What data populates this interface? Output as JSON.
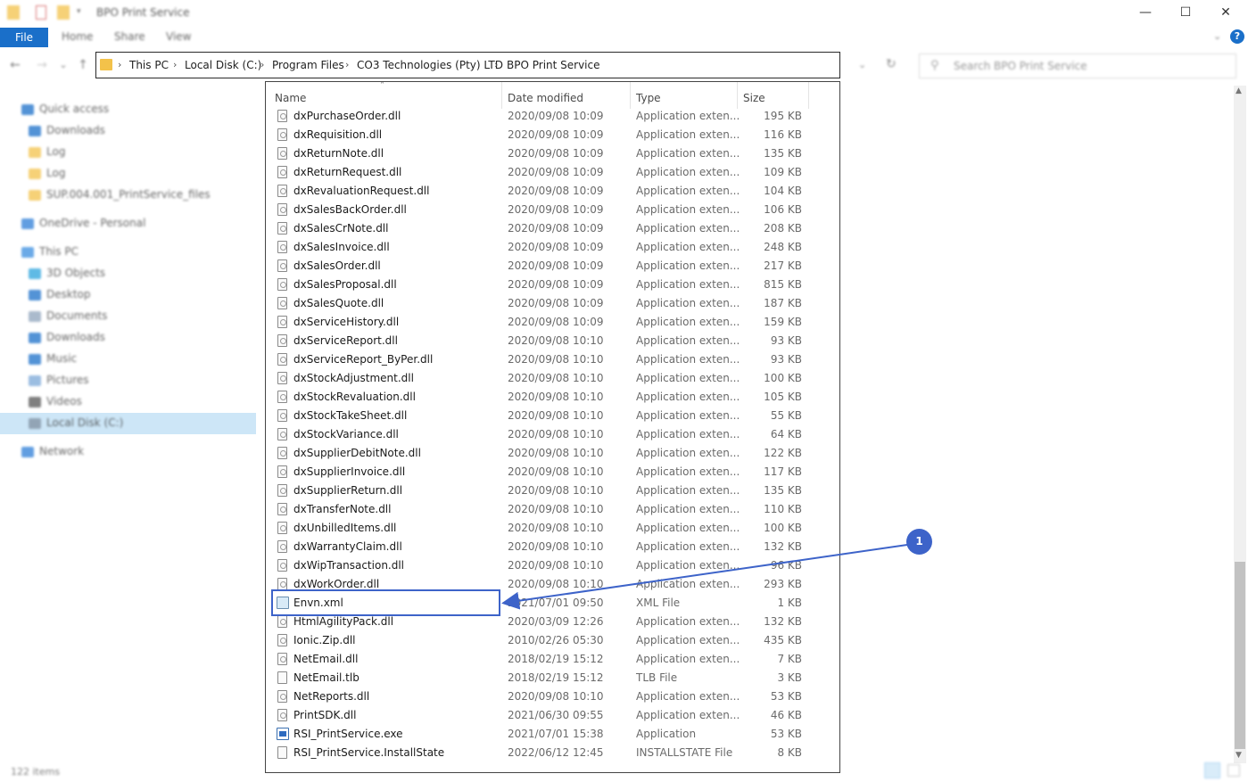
{
  "window": {
    "title": "BPO Print Service",
    "controls": {
      "minimize": "—",
      "maximize": "☐",
      "close": "✕"
    }
  },
  "ribbon": {
    "tabs": [
      "File",
      "Home",
      "Share",
      "View"
    ],
    "help": "?"
  },
  "nav": {
    "back": "←",
    "forward": "→",
    "recent": "⌄",
    "up": "↑",
    "breadcrumbs": [
      "This PC",
      "Local Disk (C:)",
      "Program Files",
      "CO3 Technologies (Pty) LTD",
      "BPO Print Service"
    ],
    "separator": "›",
    "dropdown": "⌄",
    "refresh": "↻",
    "search_placeholder": "Search BPO Print Service"
  },
  "sidebar": {
    "items": [
      {
        "label": "Quick access",
        "icon": "star-icon",
        "color": "#1a6fc9"
      },
      {
        "label": "Downloads",
        "icon": "download-icon",
        "color": "#1a6fc9"
      },
      {
        "label": "Log",
        "icon": "folder-icon",
        "color": "#f3c24a"
      },
      {
        "label": "Log",
        "icon": "folder-icon",
        "color": "#f3c24a"
      },
      {
        "label": "SUP.004.001_PrintService_files",
        "icon": "folder-icon",
        "color": "#f3c24a"
      },
      {
        "label": "OneDrive - Personal",
        "icon": "cloud-icon",
        "color": "#2d7ed8"
      },
      {
        "label": "This PC",
        "icon": "computer-icon",
        "color": "#3a8ee0"
      },
      {
        "label": "3D Objects",
        "icon": "cube-icon",
        "color": "#2aa3dd"
      },
      {
        "label": "Desktop",
        "icon": "desktop-icon",
        "color": "#1a6fc9"
      },
      {
        "label": "Documents",
        "icon": "document-icon",
        "color": "#8ea3bb"
      },
      {
        "label": "Downloads",
        "icon": "download-icon",
        "color": "#1a6fc9"
      },
      {
        "label": "Music",
        "icon": "music-icon",
        "color": "#1a6fc9"
      },
      {
        "label": "Pictures",
        "icon": "pictures-icon",
        "color": "#7aa7d8"
      },
      {
        "label": "Videos",
        "icon": "videos-icon",
        "color": "#555555"
      },
      {
        "label": "Local Disk (C:)",
        "icon": "drive-icon",
        "color": "#7f8fa0"
      },
      {
        "label": "Network",
        "icon": "network-icon",
        "color": "#2d7ed8"
      }
    ]
  },
  "columns": {
    "name": "Name",
    "date": "Date modified",
    "type": "Type",
    "size": "Size"
  },
  "files": [
    {
      "name": "dxPurchaseOrder.dll",
      "date": "2020/09/08 10:09",
      "type": "Application exten...",
      "size": "195 KB",
      "kind": "dll"
    },
    {
      "name": "dxRequisition.dll",
      "date": "2020/09/08 10:09",
      "type": "Application exten...",
      "size": "116 KB",
      "kind": "dll"
    },
    {
      "name": "dxReturnNote.dll",
      "date": "2020/09/08 10:09",
      "type": "Application exten...",
      "size": "135 KB",
      "kind": "dll"
    },
    {
      "name": "dxReturnRequest.dll",
      "date": "2020/09/08 10:09",
      "type": "Application exten...",
      "size": "109 KB",
      "kind": "dll"
    },
    {
      "name": "dxRevaluationRequest.dll",
      "date": "2020/09/08 10:09",
      "type": "Application exten...",
      "size": "104 KB",
      "kind": "dll"
    },
    {
      "name": "dxSalesBackOrder.dll",
      "date": "2020/09/08 10:09",
      "type": "Application exten...",
      "size": "106 KB",
      "kind": "dll"
    },
    {
      "name": "dxSalesCrNote.dll",
      "date": "2020/09/08 10:09",
      "type": "Application exten...",
      "size": "208 KB",
      "kind": "dll"
    },
    {
      "name": "dxSalesInvoice.dll",
      "date": "2020/09/08 10:09",
      "type": "Application exten...",
      "size": "248 KB",
      "kind": "dll"
    },
    {
      "name": "dxSalesOrder.dll",
      "date": "2020/09/08 10:09",
      "type": "Application exten...",
      "size": "217 KB",
      "kind": "dll"
    },
    {
      "name": "dxSalesProposal.dll",
      "date": "2020/09/08 10:09",
      "type": "Application exten...",
      "size": "815 KB",
      "kind": "dll"
    },
    {
      "name": "dxSalesQuote.dll",
      "date": "2020/09/08 10:09",
      "type": "Application exten...",
      "size": "187 KB",
      "kind": "dll"
    },
    {
      "name": "dxServiceHistory.dll",
      "date": "2020/09/08 10:09",
      "type": "Application exten...",
      "size": "159 KB",
      "kind": "dll"
    },
    {
      "name": "dxServiceReport.dll",
      "date": "2020/09/08 10:10",
      "type": "Application exten...",
      "size": "93 KB",
      "kind": "dll"
    },
    {
      "name": "dxServiceReport_ByPer.dll",
      "date": "2020/09/08 10:10",
      "type": "Application exten...",
      "size": "93 KB",
      "kind": "dll"
    },
    {
      "name": "dxStockAdjustment.dll",
      "date": "2020/09/08 10:10",
      "type": "Application exten...",
      "size": "100 KB",
      "kind": "dll"
    },
    {
      "name": "dxStockRevaluation.dll",
      "date": "2020/09/08 10:10",
      "type": "Application exten...",
      "size": "105 KB",
      "kind": "dll"
    },
    {
      "name": "dxStockTakeSheet.dll",
      "date": "2020/09/08 10:10",
      "type": "Application exten...",
      "size": "55 KB",
      "kind": "dll"
    },
    {
      "name": "dxStockVariance.dll",
      "date": "2020/09/08 10:10",
      "type": "Application exten...",
      "size": "64 KB",
      "kind": "dll"
    },
    {
      "name": "dxSupplierDebitNote.dll",
      "date": "2020/09/08 10:10",
      "type": "Application exten...",
      "size": "122 KB",
      "kind": "dll"
    },
    {
      "name": "dxSupplierInvoice.dll",
      "date": "2020/09/08 10:10",
      "type": "Application exten...",
      "size": "117 KB",
      "kind": "dll"
    },
    {
      "name": "dxSupplierReturn.dll",
      "date": "2020/09/08 10:10",
      "type": "Application exten...",
      "size": "135 KB",
      "kind": "dll"
    },
    {
      "name": "dxTransferNote.dll",
      "date": "2020/09/08 10:10",
      "type": "Application exten...",
      "size": "110 KB",
      "kind": "dll"
    },
    {
      "name": "dxUnbilledItems.dll",
      "date": "2020/09/08 10:10",
      "type": "Application exten...",
      "size": "100 KB",
      "kind": "dll"
    },
    {
      "name": "dxWarrantyClaim.dll",
      "date": "2020/09/08 10:10",
      "type": "Application exten...",
      "size": "132 KB",
      "kind": "dll"
    },
    {
      "name": "dxWipTransaction.dll",
      "date": "2020/09/08 10:10",
      "type": "Application exten...",
      "size": "96 KB",
      "kind": "dll"
    },
    {
      "name": "dxWorkOrder.dll",
      "date": "2020/09/08 10:10",
      "type": "Application exten...",
      "size": "293 KB",
      "kind": "dll"
    },
    {
      "name": "Envn.xml",
      "date": "2021/07/01 09:50",
      "type": "XML File",
      "size": "1 KB",
      "kind": "xml"
    },
    {
      "name": "HtmlAgilityPack.dll",
      "date": "2020/03/09 12:26",
      "type": "Application exten...",
      "size": "132 KB",
      "kind": "dll"
    },
    {
      "name": "Ionic.Zip.dll",
      "date": "2010/02/26 05:30",
      "type": "Application exten...",
      "size": "435 KB",
      "kind": "dll"
    },
    {
      "name": "NetEmail.dll",
      "date": "2018/02/19 15:12",
      "type": "Application exten...",
      "size": "7 KB",
      "kind": "dll"
    },
    {
      "name": "NetEmail.tlb",
      "date": "2018/02/19 15:12",
      "type": "TLB File",
      "size": "3 KB",
      "kind": "file"
    },
    {
      "name": "NetReports.dll",
      "date": "2020/09/08 10:10",
      "type": "Application exten...",
      "size": "53 KB",
      "kind": "dll"
    },
    {
      "name": "PrintSDK.dll",
      "date": "2021/06/30 09:55",
      "type": "Application exten...",
      "size": "46 KB",
      "kind": "dll"
    },
    {
      "name": "RSI_PrintService.exe",
      "date": "2021/07/01 15:38",
      "type": "Application",
      "size": "53 KB",
      "kind": "exe"
    },
    {
      "name": "RSI_PrintService.InstallState",
      "date": "2022/06/12 12:45",
      "type": "INSTALLSTATE File",
      "size": "8 KB",
      "kind": "file"
    }
  ],
  "status": {
    "item_count": "122 items"
  },
  "annotation": {
    "badge": "1",
    "color": "#3d63c9"
  }
}
